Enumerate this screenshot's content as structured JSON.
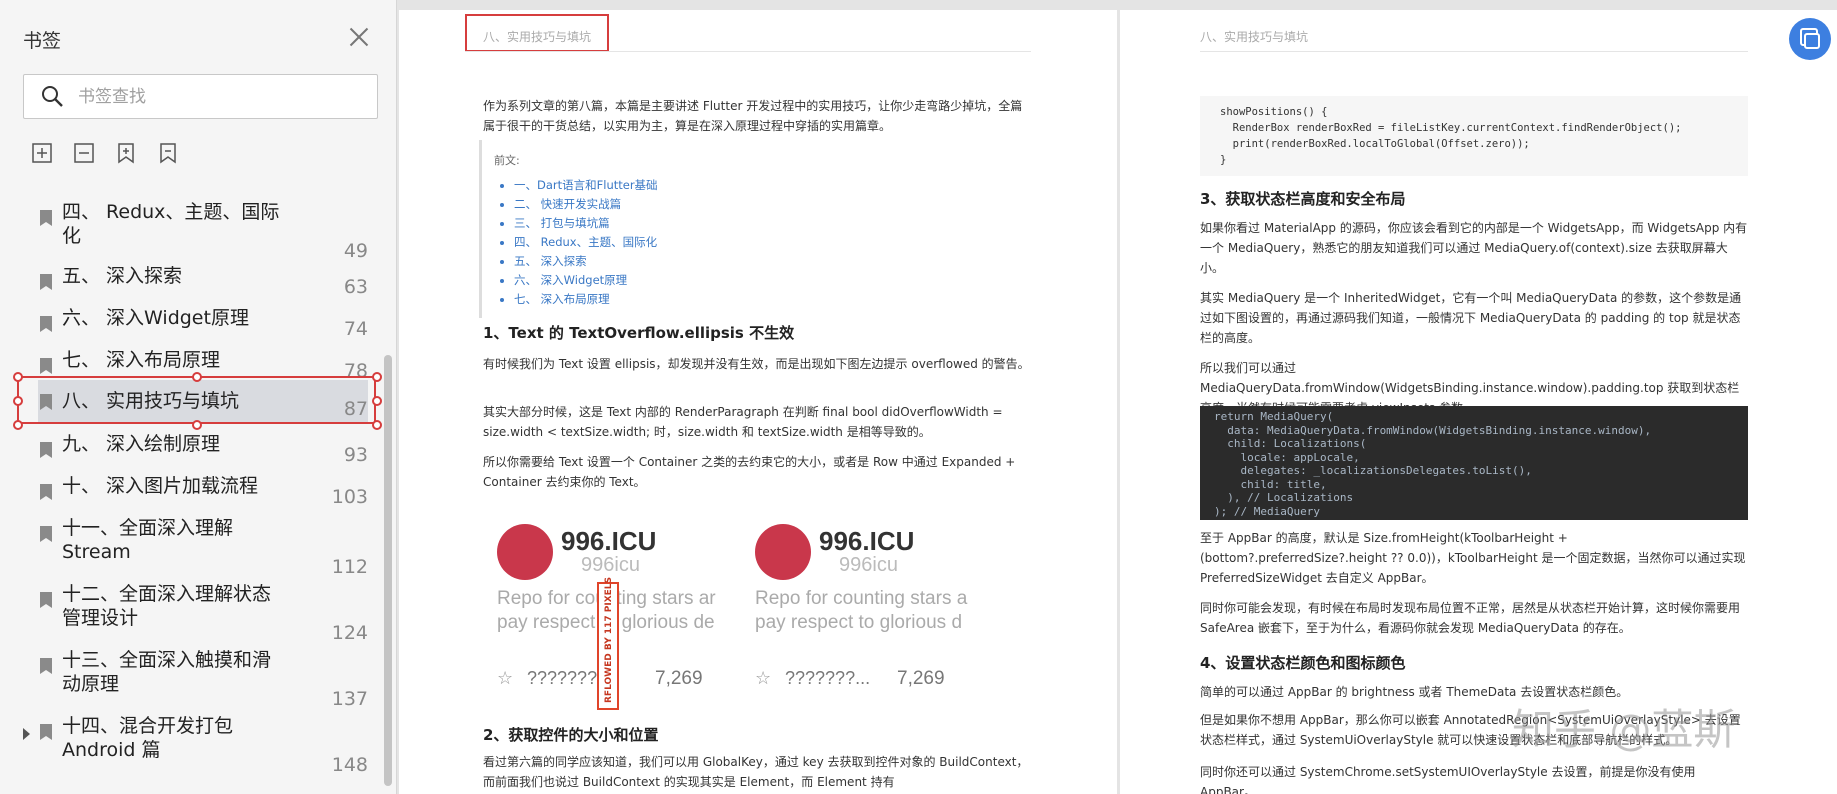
{
  "sidebar": {
    "title": "书签",
    "search_placeholder": "书签查找",
    "bookmarks": [
      {
        "label": "四、 Redux、主题、国际化",
        "page": "49"
      },
      {
        "label": "五、 深入探索",
        "page": "63"
      },
      {
        "label": "六、 深入Widget原理",
        "page": "74"
      },
      {
        "label": "七、 深入布局原理",
        "page": "78"
      },
      {
        "label": "八、 实用技巧与填坑",
        "page": "87"
      },
      {
        "label": "九、 深入绘制原理",
        "page": "93"
      },
      {
        "label": "十、 深入图片加载流程",
        "page": "103"
      },
      {
        "label": "十一、全面深入理解Stream",
        "page": "112"
      },
      {
        "label": "十二、全面深入理解状态管理设计",
        "page": "124"
      },
      {
        "label": "十三、全面深入触摸和滑动原理",
        "page": "137"
      },
      {
        "label": "十四、混合开发打包 Android 篇",
        "page": "148"
      }
    ]
  },
  "page1": {
    "header": "八、实用技巧与填坑",
    "intro": "作为系列文章的第八篇，本篇是主要讲述 Flutter 开发过程中的实用技巧，让你少走弯路少掉坑，全篇属于很干的干货总结，以实用为主，算是在深入原理过程中穿插的实用篇章。",
    "quote_label": "前文:",
    "toc": [
      "一、Dart语言和Flutter基础",
      "二、 快速开发实战篇",
      "三、 打包与填坑篇",
      "四、 Redux、主题、国际化",
      "五、 深入探索",
      "六、 深入Widget原理",
      "七、 深入布局原理"
    ],
    "h1": "1、Text 的 TextOverflow.ellipsis 不生效",
    "p1": "有时候我们为 Text 设置 ellipsis，却发现并没有生效，而是出现如下图左边提示 overflowed 的警告。",
    "p2": "其实大部分时候，这是 Text 内部的 RenderParagraph 在判断 final bool didOverflowWidth = size.width < textSize.width; 时，size.width 和 textSize.width 是相等导致的。",
    "p3": "所以你需要给 Text 设置一个 Container 之类的去约束它的大小，或者是 Row 中通过 Expanded + Container 去约束你的 Text。",
    "card_title": "996.ICU",
    "card_user": "996icu",
    "card_desc1": "Repo for counting stars ar",
    "card_desc2": "pay respect to glorious de",
    "card_desc1b": "Repo for counting stars a",
    "card_desc2b": "pay respect to glorious d",
    "card_stars1": "???????",
    "card_stars2": "???????...",
    "card_count": "7,269",
    "overflow_label": "RFLOWED BY 117 PIXELS",
    "h2": "2、获取控件的大小和位置",
    "p4": "看过第六篇的同学应该知道，我们可以用 GlobalKey，通过 key 去获取到控件对象的 BuildContext，而前面我们也说过 BuildContext 的实现其实是 Element，而 Element 持有"
  },
  "page2": {
    "header": "八、实用技巧与填坑",
    "code": "showPositions() {\n  RenderBox renderBoxRed = fileListKey.currentContext.findRenderObject();\n  print(renderBoxRed.localToGlobal(Offset.zero));\n}",
    "h3": "3、获取状态栏高度和安全布局",
    "p1": "如果你看过 MaterialApp 的源码，你应该会看到它的内部是一个 WidgetsApp，而 WidgetsApp 内有一个 MediaQuery，熟悉它的朋友知道我们可以通过 MediaQuery.of(context).size 去获取屏幕大小。",
    "p2": "其实 MediaQuery 是一个 InheritedWidget，它有一个叫 MediaQueryData 的参数，这个参数是通过如下图设置的，再通过源码我们知道，一般情况下 MediaQueryData 的 padding 的 top 就是状态栏的高度。",
    "p3": "所以我们可以通过 MediaQueryData.fromWindow(WidgetsBinding.instance.window).padding.top 获取到状态栏高度，当然有时候可能需要考虑 viewInsets 参数。",
    "dark_code": "return MediaQuery(\n  data: MediaQueryData.fromWindow(WidgetsBinding.instance.window),\n  child: Localizations(\n    locale: appLocale,\n    delegates: _localizationsDelegates.toList(),\n    child: title,\n  ), // Localizations\n); // MediaQuery",
    "p4": "至于 AppBar 的高度，默认是 Size.fromHeight(kToolbarHeight + (bottom?.preferredSize?.height ?? 0.0))，kToolbarHeight 是一个固定数据，当然你可以通过实现 PreferredSizeWidget 去自定义 AppBar。",
    "p5": "同时你可能会发现，有时候在布局时发现布局位置不正常，居然是从状态栏开始计算，这时候你需要用 SafeArea 嵌套下，至于为什么，看源码你就会发现 MediaQueryData 的存在。",
    "h4": "4、设置状态栏颜色和图标颜色",
    "p6": "简单的可以通过 AppBar 的 brightness 或者 ThemeData 去设置状态栏颜色。",
    "p7": "但是如果你不想用 AppBar，那么你可以嵌套 AnnotatedRegion<SystemUiOverlayStyle> 去设置状态栏样式，通过 SystemUiOverlayStyle 就可以快速设置状态栏和底部导航栏的样式。",
    "p8": "同时你还可以通过 SystemChrome.setSystemUIOverlayStyle 去设置，前提是你没有使用 AppBar。",
    "watermark": "知乎 @蓝斯"
  }
}
